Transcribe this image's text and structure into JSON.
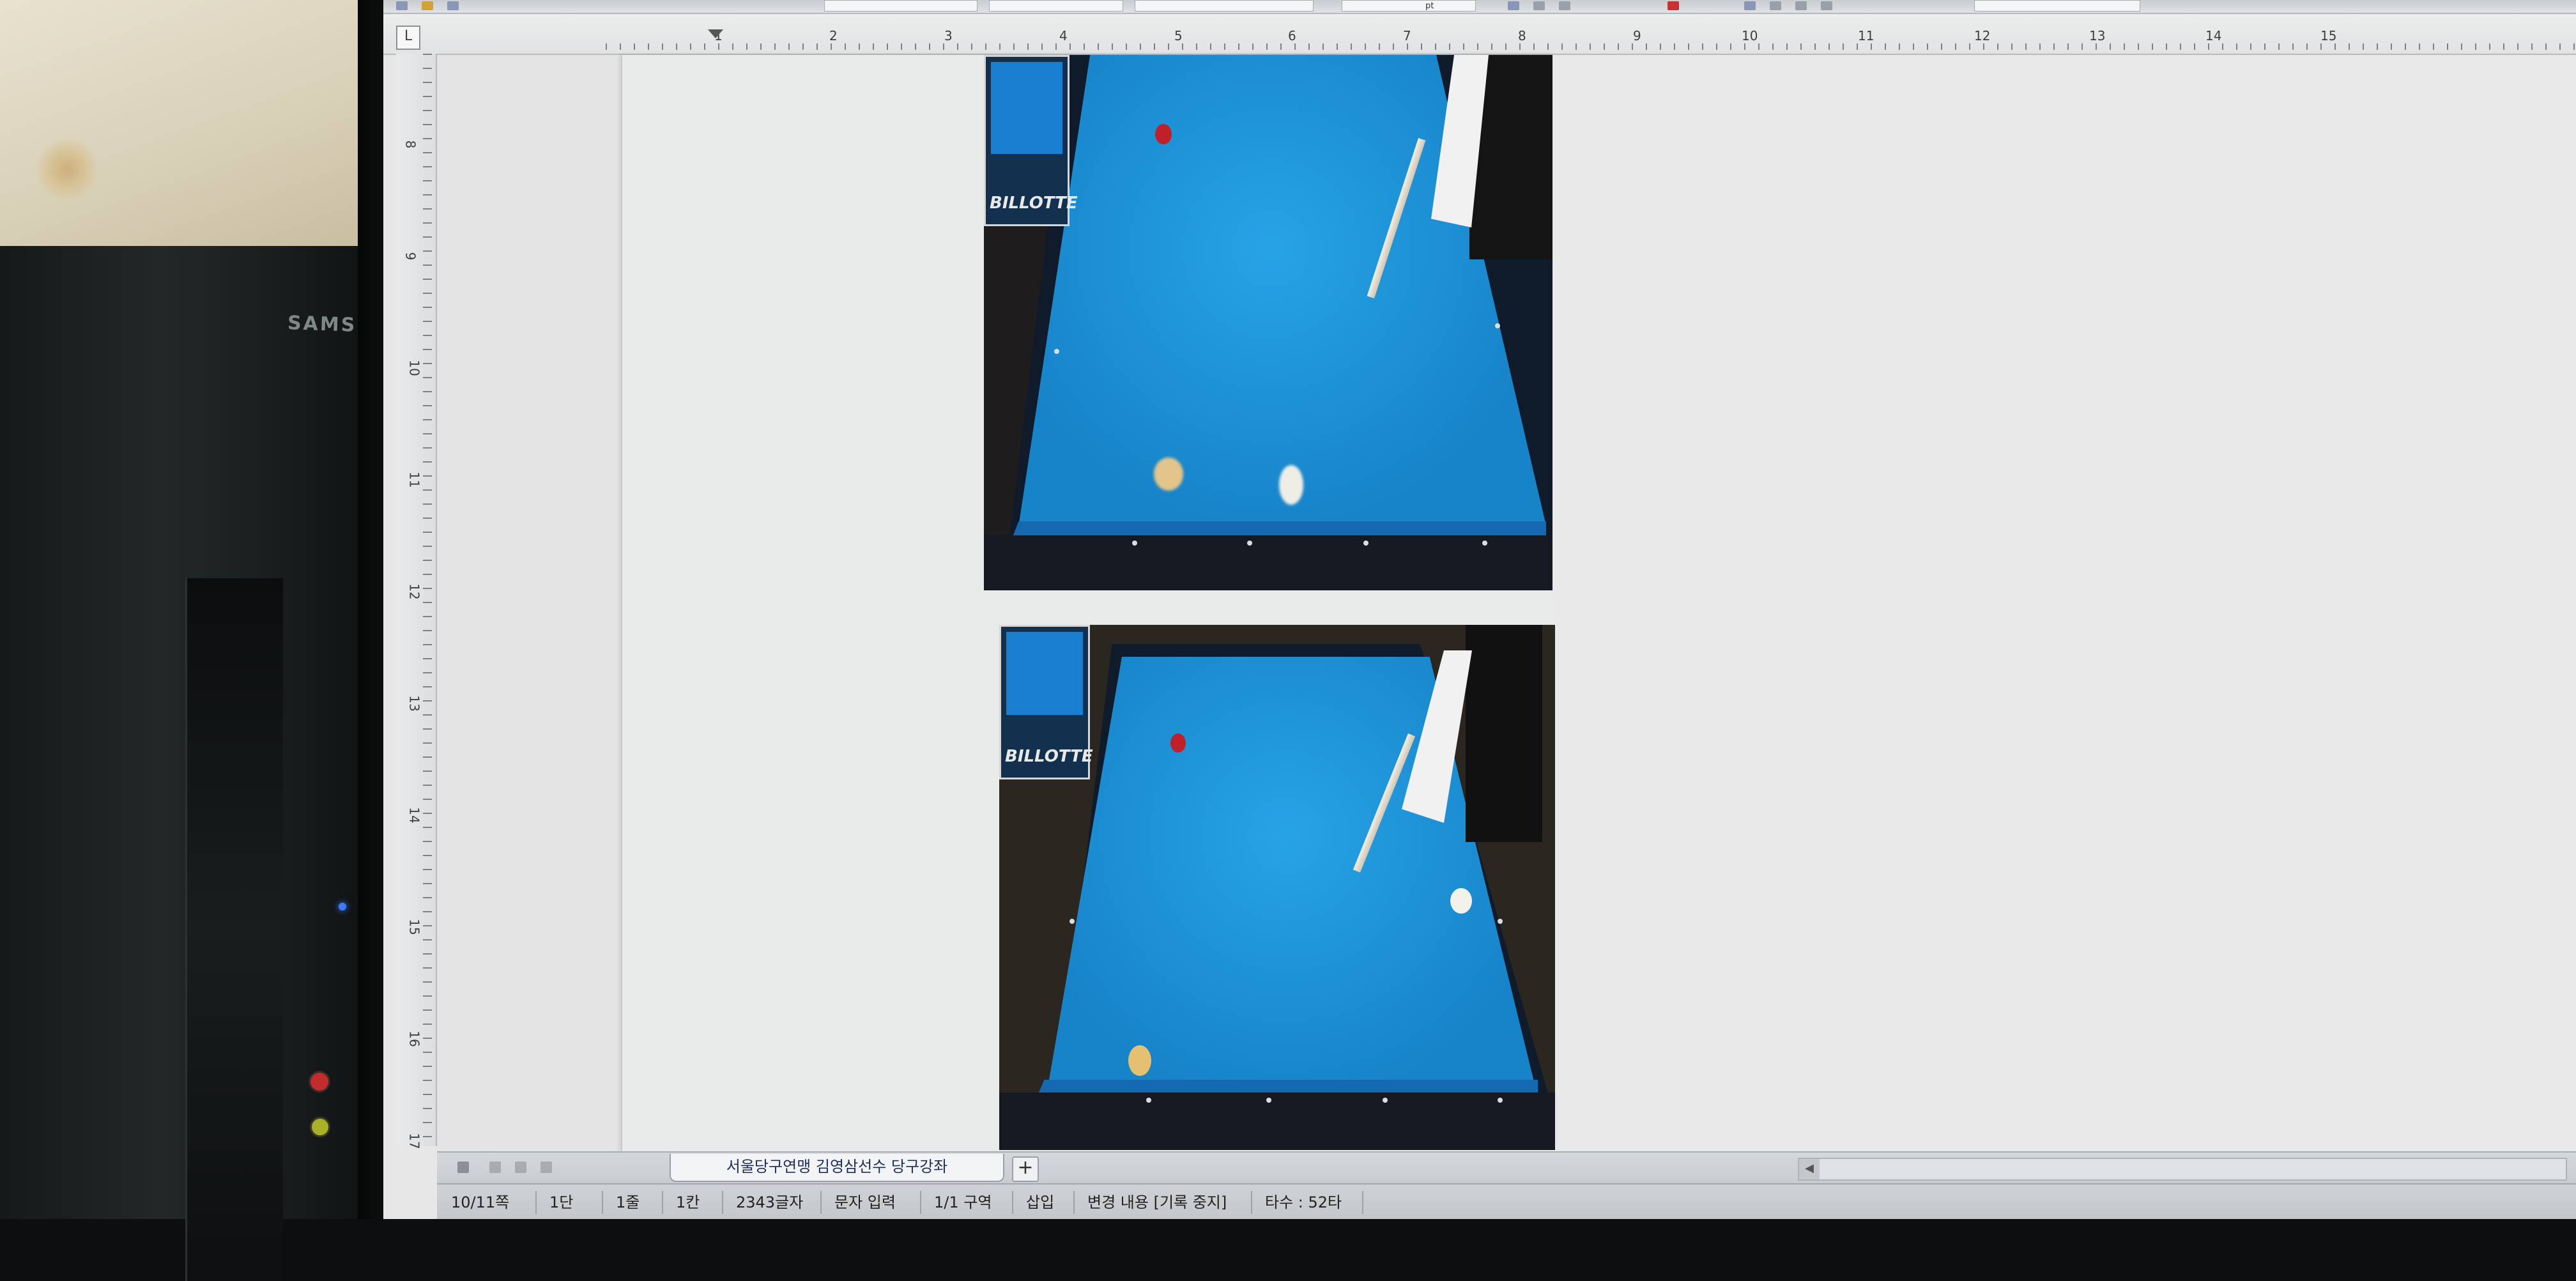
{
  "environment": {
    "pc_brand": "SAMS"
  },
  "toolbar": {
    "style_value": "",
    "font_value": "",
    "size_value": "",
    "size_unit": "pt"
  },
  "ruler": {
    "corner_label": "L",
    "horizontal_numbers": [
      "1",
      "2",
      "3",
      "4",
      "5",
      "6",
      "7",
      "8",
      "9",
      "10",
      "11",
      "12",
      "13",
      "14",
      "15"
    ],
    "vertical_numbers": [
      "8",
      "9",
      "10",
      "11",
      "12",
      "13",
      "14",
      "15",
      "16",
      "17"
    ]
  },
  "document": {
    "inset_logo_1": "BILLOTTE",
    "inset_logo_2": "BILLOTTE"
  },
  "tabs": {
    "document_tab": "서울당구연맹 김영삼선수 당구강좌",
    "add_tab": "+"
  },
  "status_bar": {
    "page": "10/11쪽",
    "column": "1단",
    "line": "1줄",
    "char_pos": "1칸",
    "char_count": "2343글자",
    "input_mode": "문자 입력",
    "section": "1/1 구역",
    "insert_mode": "삽입",
    "track_changes": "변경 내용 [기록 중지]",
    "typing_speed": "타수 : 52타"
  },
  "colors": {
    "felt": "#1e8fd6",
    "rail": "#0f1b2a",
    "red_ball": "#c0202a",
    "yellow_ball": "#e5c070",
    "white_ball": "#f2f2ea"
  }
}
